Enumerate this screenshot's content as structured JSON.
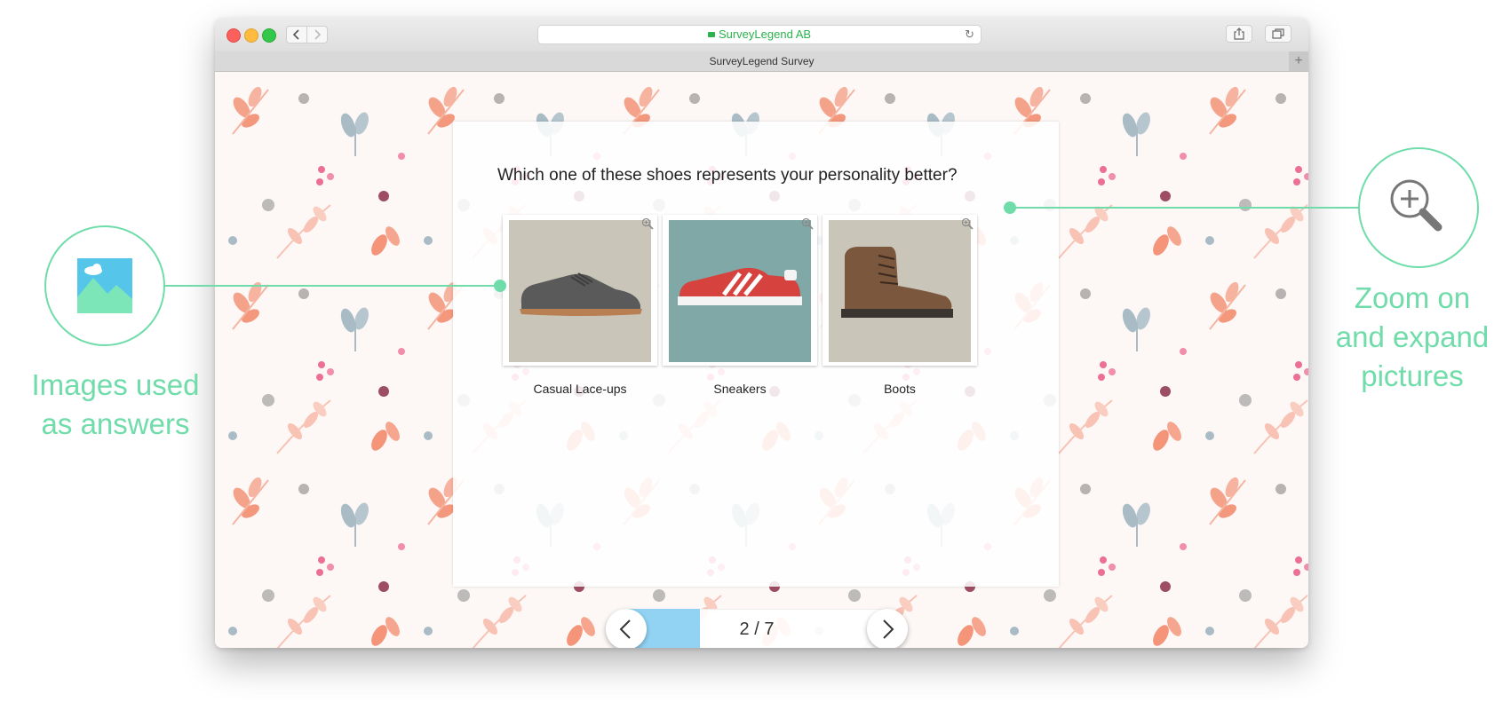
{
  "browser": {
    "url_text": "SurveyLegend AB",
    "tab_title": "SurveyLegend Survey",
    "back_icon": "chevron-left-icon",
    "forward_icon": "chevron-right-icon",
    "reload_icon": "reload-icon",
    "share_icon": "share-icon",
    "tabs_icon": "tabs-icon",
    "new_tab_label": "+"
  },
  "survey": {
    "question": "Which one of these shoes represents your personality better?",
    "options": [
      {
        "label": "Casual Lace-ups",
        "image": "casual-shoe",
        "bg": "#c9c5b9"
      },
      {
        "label": "Sneakers",
        "image": "sneaker",
        "bg": "#7fa8a6"
      },
      {
        "label": "Boots",
        "image": "boot",
        "bg": "#c9c5b9"
      }
    ],
    "pager": {
      "text": "2 / 7",
      "progress": 0.2857
    }
  },
  "callouts": {
    "left_text": "Images used\nas answers",
    "right_text": "Zoom on\nand expand\npictures",
    "accent": "#6fdcaa"
  }
}
